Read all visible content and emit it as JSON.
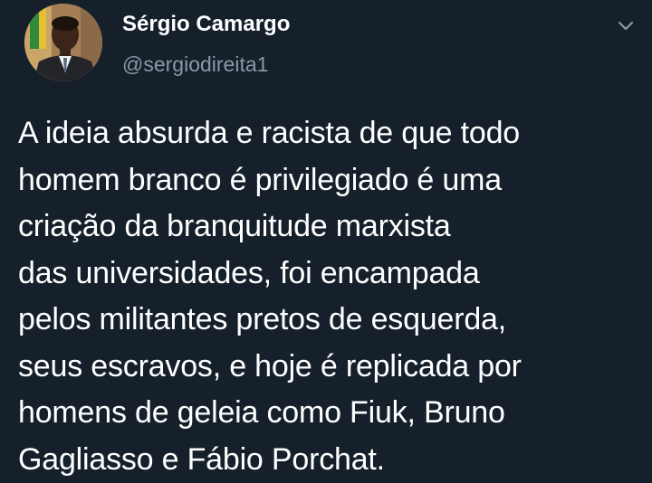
{
  "tweet": {
    "author": {
      "display_name": "Sérgio Camargo",
      "handle": "@sergiodireita1"
    },
    "text_lines": [
      "A ideia absurda e racista de que todo",
      "homem branco é privilegiado é uma",
      "criação da branquitude marxista",
      "das universidades, foi encampada",
      "pelos militantes pretos de esquerda,",
      "seus escravos, e hoje é replicada por",
      "homens de geleia como Fiuk, Bruno",
      "Gagliasso e Fábio Porchat."
    ],
    "menu_icon": "chevron-down-icon"
  },
  "theme": {
    "background": "#15202b",
    "text": "#ffffff",
    "secondary_text": "#8899a6"
  }
}
